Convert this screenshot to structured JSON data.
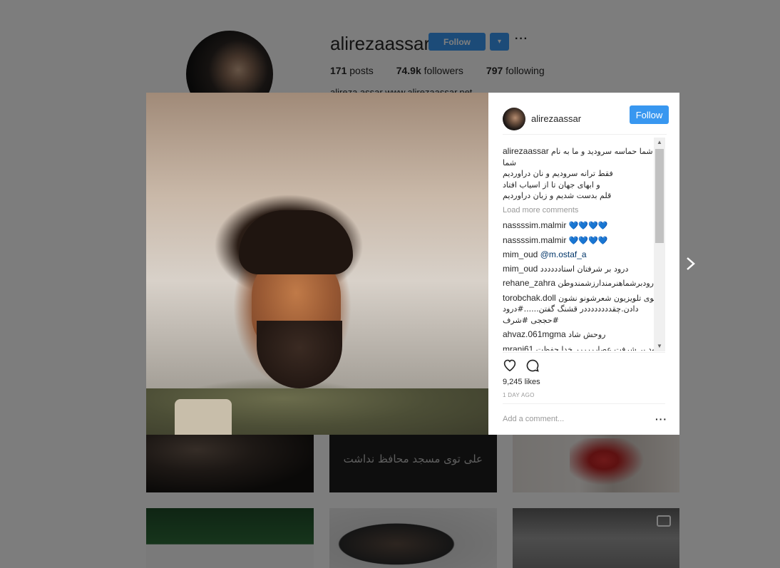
{
  "profile": {
    "username": "alirezaassar",
    "follow_label": "Follow",
    "dropdown_glyph": "▾",
    "more_glyph": "···",
    "stats": {
      "posts_count": "171",
      "posts_label": "posts",
      "followers_count": "74.9k",
      "followers_label": "followers",
      "following_count": "797",
      "following_label": "following"
    },
    "fullname": "alireza assar www.alirezaassar.net"
  },
  "grid": {
    "tile2_caption": "علی توی مسجد محافظ نداشت"
  },
  "modal": {
    "username": "alirezaassar",
    "follow_label": "Follow",
    "caption_user": "alirezaassar",
    "caption_lines": [
      "شما حماسه سرودید و ما به نام",
      "شما",
      "فقط ترانه سرودیم و نان دراوردیم",
      "و ابهای جهان تا از اسیاب افتاد",
      "قلم بدست شدیم و زبان دراوردیم"
    ],
    "load_more": "Load more comments",
    "comments": [
      {
        "user": "nassssim.malmir",
        "text": "💙💙💙💙"
      },
      {
        "user": "nassssim.malmir",
        "text": "💙💙💙💙"
      },
      {
        "user": "mim_oud",
        "text": "@m.ostaf_a"
      },
      {
        "user": "mim_oud",
        "text": "درود بر شرفتان استادددددد"
      },
      {
        "user": "rehane_zahra",
        "text": "درودبرشماهنرمندارزشمندوطن"
      },
      {
        "user": "torobchak.doll",
        "text": "توی تلویزیون شعرشونو نشون دادن.چقددددددددر قشنگ گفتن......#درود #حججی #شرف"
      },
      {
        "user": "ahvaz.061mgma",
        "text": "روحش شاد"
      },
      {
        "user": "mranj61",
        "text": "درود بر شرفت عصارررررر خدا حفظت کنه"
      }
    ],
    "likes": "9,245 likes",
    "time": "1 DAY AGO",
    "add_comment_placeholder": "Add a comment...",
    "more_glyph": "···",
    "accent": "#3897f0"
  }
}
